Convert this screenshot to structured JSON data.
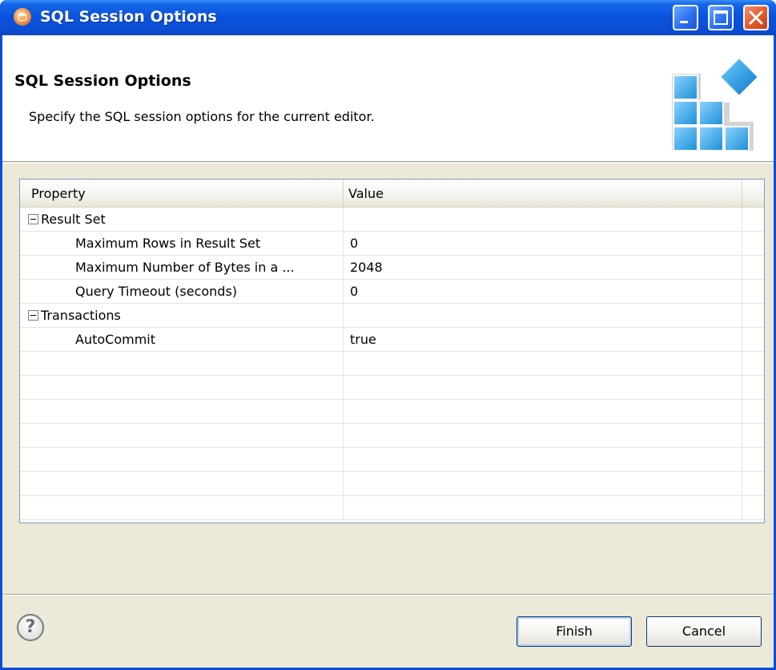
{
  "window": {
    "title": "SQL Session Options"
  },
  "banner": {
    "title": "SQL Session Options",
    "description": "Specify the SQL session options for the current editor."
  },
  "table": {
    "columns": [
      "Property",
      "Value"
    ],
    "rows": [
      {
        "type": "group",
        "label": "Result Set",
        "value": ""
      },
      {
        "type": "child",
        "label": "Maximum Rows in Result Set",
        "value": "0"
      },
      {
        "type": "child",
        "label": "Maximum Number of Bytes in a ...",
        "value": "2048"
      },
      {
        "type": "child",
        "label": "Query Timeout (seconds)",
        "value": "0"
      },
      {
        "type": "group",
        "label": "Transactions",
        "value": ""
      },
      {
        "type": "child",
        "label": "AutoCommit",
        "value": "true"
      },
      {
        "type": "empty",
        "label": "",
        "value": ""
      },
      {
        "type": "empty",
        "label": "",
        "value": ""
      },
      {
        "type": "empty",
        "label": "",
        "value": ""
      },
      {
        "type": "empty",
        "label": "",
        "value": ""
      },
      {
        "type": "empty",
        "label": "",
        "value": ""
      },
      {
        "type": "empty",
        "label": "",
        "value": ""
      },
      {
        "type": "empty",
        "label": "",
        "value": ""
      }
    ]
  },
  "buttons": {
    "help": "?",
    "finish": "Finish",
    "cancel": "Cancel"
  }
}
